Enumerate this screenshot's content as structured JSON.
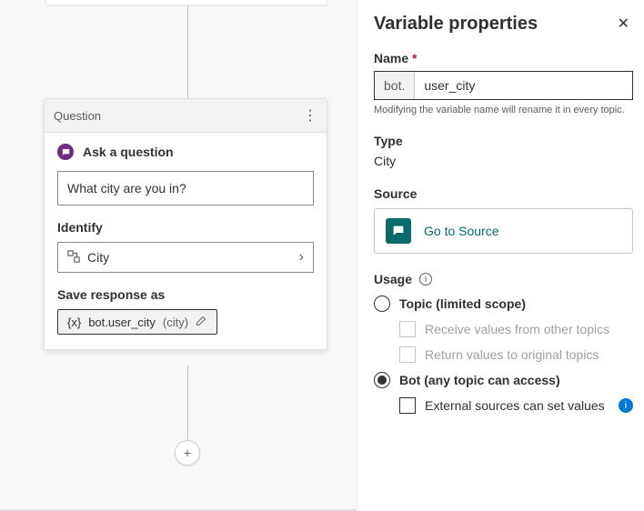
{
  "card": {
    "header": "Question",
    "ask_label": "Ask a question",
    "question_text": "What city are you in?",
    "identify_label": "Identify",
    "identify_value": "City",
    "save_label": "Save response as",
    "var_token": "bot.user_city",
    "var_type": "(city)"
  },
  "panel": {
    "title": "Variable properties",
    "name_label": "Name",
    "name_prefix": "bot.",
    "name_value": "user_city",
    "name_hint": "Modifying the variable name will rename it in every topic.",
    "type_label": "Type",
    "type_value": "City",
    "source_label": "Source",
    "source_btn": "Go to Source",
    "usage_label": "Usage",
    "usage_topic": "Topic (limited scope)",
    "usage_receive": "Receive values from other topics",
    "usage_return": "Return values to original topics",
    "usage_bot": "Bot (any topic can access)",
    "usage_external": "External sources can set values"
  }
}
